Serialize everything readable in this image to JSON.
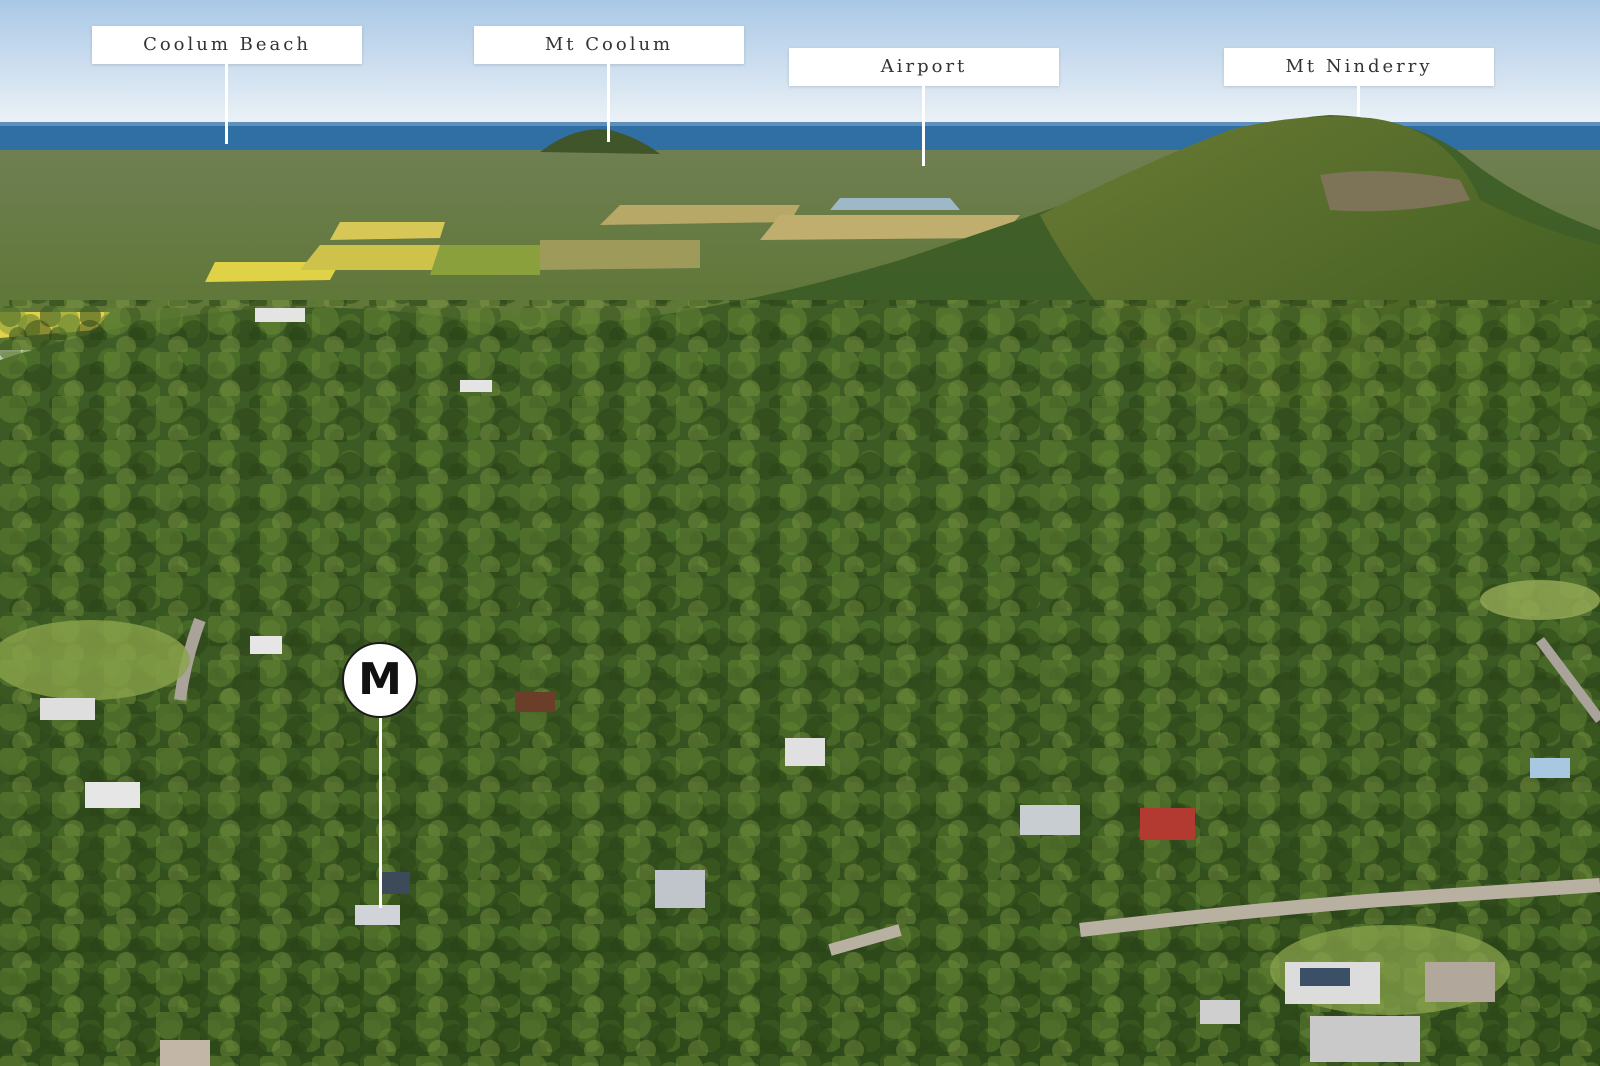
{
  "image": {
    "description_kind": "aerial real-estate photo with location callouts",
    "colors": {
      "sky_top": "#b9d3ea",
      "sky_bottom": "#eef4f8",
      "ocean": "#2f6fa3",
      "forest_dark": "#2f4a1c",
      "forest_mid": "#4e6d2a",
      "forest_light": "#7a9440",
      "fields_yellow": "#e3d34c",
      "label_bg": "#ffffff",
      "label_text": "#333333"
    }
  },
  "callouts": [
    {
      "label": "Coolum Beach"
    },
    {
      "label": "Mt Coolum"
    },
    {
      "label": "Airport"
    },
    {
      "label": "Mt Ninderry"
    }
  ],
  "marker": {
    "letter": "M",
    "icon": "location-pin-icon"
  }
}
